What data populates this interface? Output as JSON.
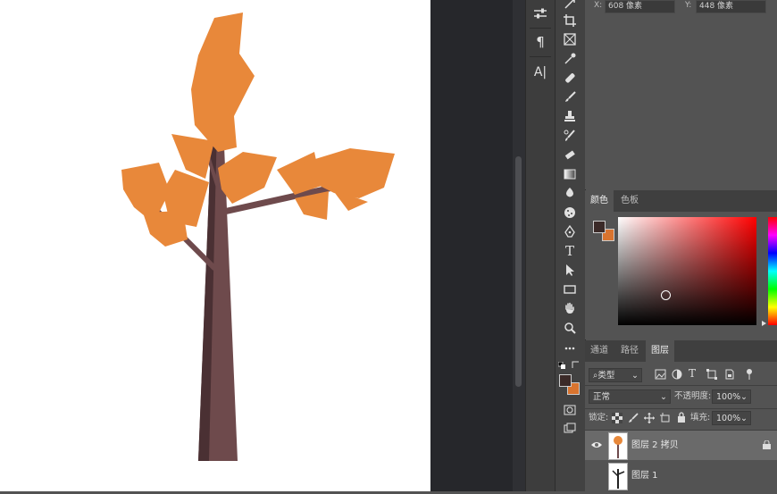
{
  "info": {
    "x_label": "X:",
    "x_value": "608 像素",
    "y_label": "Y:",
    "y_value": "448 像素"
  },
  "color_panel": {
    "tabs": [
      {
        "label": "颜色",
        "active": true
      },
      {
        "label": "色板",
        "active": false
      }
    ],
    "foreground_color": "#3b2a28",
    "background_color": "#d9742f",
    "base_hue": "#ff0000"
  },
  "layers_panel": {
    "tabs": [
      {
        "label": "通道",
        "active": false
      },
      {
        "label": "路径",
        "active": false
      },
      {
        "label": "图层",
        "active": true
      }
    ],
    "filter_kind": "类型",
    "blend_mode": "正常",
    "opacity_label": "不透明度:",
    "opacity_value": "100%",
    "lock_label": "锁定:",
    "fill_label": "填充:",
    "fill_value": "100%",
    "layers": [
      {
        "name": "图层 2 拷贝",
        "visible": true,
        "selected": true,
        "locked": true
      },
      {
        "name": "图层 1",
        "visible": false,
        "selected": false,
        "locked": false
      }
    ]
  },
  "toolbar": {
    "tools": [
      "move-tool",
      "crop-tool",
      "frame-tool",
      "eyedropper-tool",
      "healing-brush-tool",
      "brush-tool",
      "clone-stamp-tool",
      "history-brush-tool",
      "eraser-tool",
      "gradient-tool",
      "blur-tool",
      "sponge-tool",
      "pen-tool",
      "type-tool",
      "path-selection-tool",
      "rectangle-tool",
      "hand-tool",
      "zoom-tool",
      "more-tools"
    ],
    "type_glyph": "T"
  },
  "panel_strip": {
    "paragraph_glyph": "¶",
    "character_glyph": "A|"
  },
  "artwork": {
    "leaf_color": "#e8883a",
    "trunk_color": "#6e4a4c",
    "trunk_shadow": "#4a3033",
    "branch_color": "#7a5456"
  }
}
